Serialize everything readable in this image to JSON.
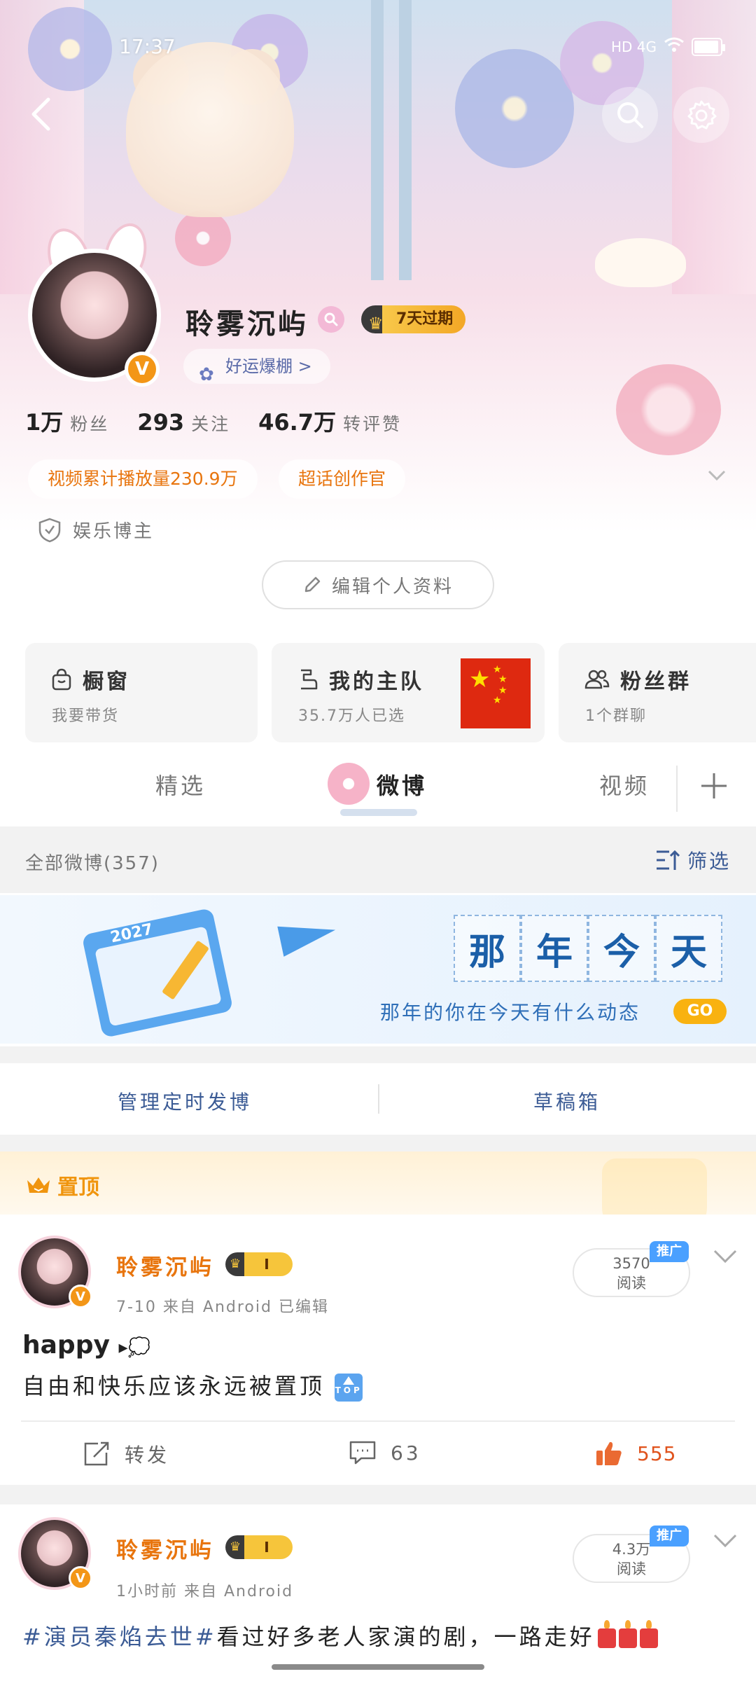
{
  "status_bar": {
    "time": "17:37",
    "network": "HD 4G",
    "battery_level": 0.95
  },
  "profile": {
    "username": "聆雾沉屿",
    "vip_label": "7天过期",
    "luck_label": "好运爆棚 >",
    "stats": [
      {
        "value": "1万",
        "label": "粉丝"
      },
      {
        "value": "293",
        "label": "关注"
      },
      {
        "value": "46.7万",
        "label": "转评赞"
      }
    ],
    "tags": [
      "视频累计播放量230.9万",
      "超话创作官"
    ],
    "identity": "娱乐博主",
    "edit_button": "编辑个人资料"
  },
  "cards": [
    {
      "title": "橱窗",
      "subtitle": "我要带货",
      "icon": "shop-bag-icon"
    },
    {
      "title": "我的主队",
      "subtitle": "35.7万人已选",
      "icon": "team-icon"
    },
    {
      "title": "粉丝群",
      "subtitle": "1个群聊",
      "icon": "group-icon"
    }
  ],
  "tabs": {
    "items": [
      "精选",
      "微博",
      "视频"
    ],
    "active": "微博"
  },
  "all_weibo": {
    "label": "全部微博(357)",
    "filter": "筛选"
  },
  "on_this_day": {
    "chars": [
      "那",
      "年",
      "今",
      "天"
    ],
    "calendar_year": "2027",
    "subtitle": "那年的你在今天有什么动态",
    "go": "GO"
  },
  "manage": {
    "left": "管理定时发博",
    "right": "草稿箱"
  },
  "pinned_label": "置顶",
  "posts": [
    {
      "name": "聆雾沉屿",
      "level": "I",
      "meta": "7-10  来自 Android  已编辑",
      "reads_value": "3570",
      "reads_label": "阅读",
      "promo": "推广",
      "line1": "happy",
      "line2": "自由和快乐应该永远被置顶",
      "top_icon_text": "TOP",
      "repost": "转发",
      "comments": "63",
      "likes": "555"
    },
    {
      "name": "聆雾沉屿",
      "level": "I",
      "meta": "1小时前  来自 Android",
      "reads_value": "4.3万",
      "reads_label": "阅读",
      "promo": "推广",
      "hashtag": "#演员秦焰去世#",
      "text": "看过好多老人家演的剧，一路走好"
    }
  ],
  "colors": {
    "accent_orange": "#e8750e",
    "link_blue": "#3b5b95",
    "like_red": "#e0531d",
    "vip_gold": "#f3a726"
  }
}
